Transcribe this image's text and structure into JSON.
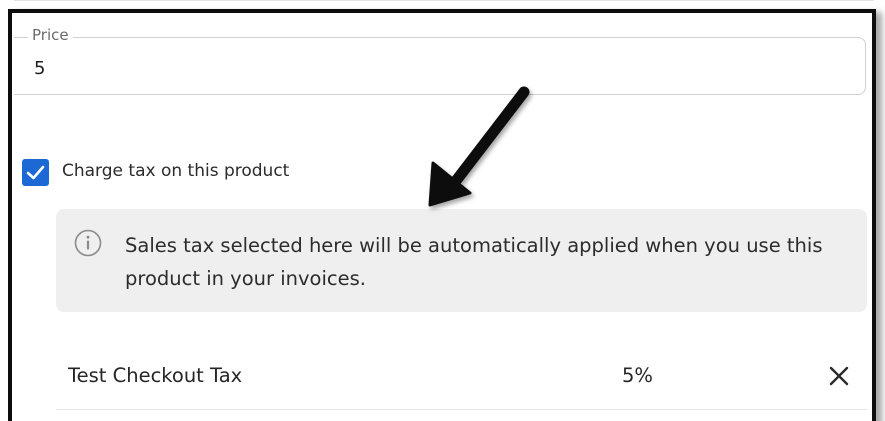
{
  "form": {
    "price": {
      "label": "Price",
      "value": "5"
    },
    "charge_tax": {
      "checked": true,
      "label": "Charge tax on this product"
    },
    "info_message": "Sales tax selected here will be automatically applied when you use this product in your invoices.",
    "taxes": [
      {
        "name": "Test Checkout Tax",
        "rate": "5%"
      }
    ]
  },
  "icons": {
    "checkbox": "checkmark-icon",
    "info": "info-icon",
    "remove": "close-icon",
    "annotation": "arrow-icon"
  },
  "colors": {
    "checkbox_fill": "#1c68d4",
    "info_background": "#efefef",
    "frame_border": "#0d0d0d",
    "arrow": "#111111"
  }
}
